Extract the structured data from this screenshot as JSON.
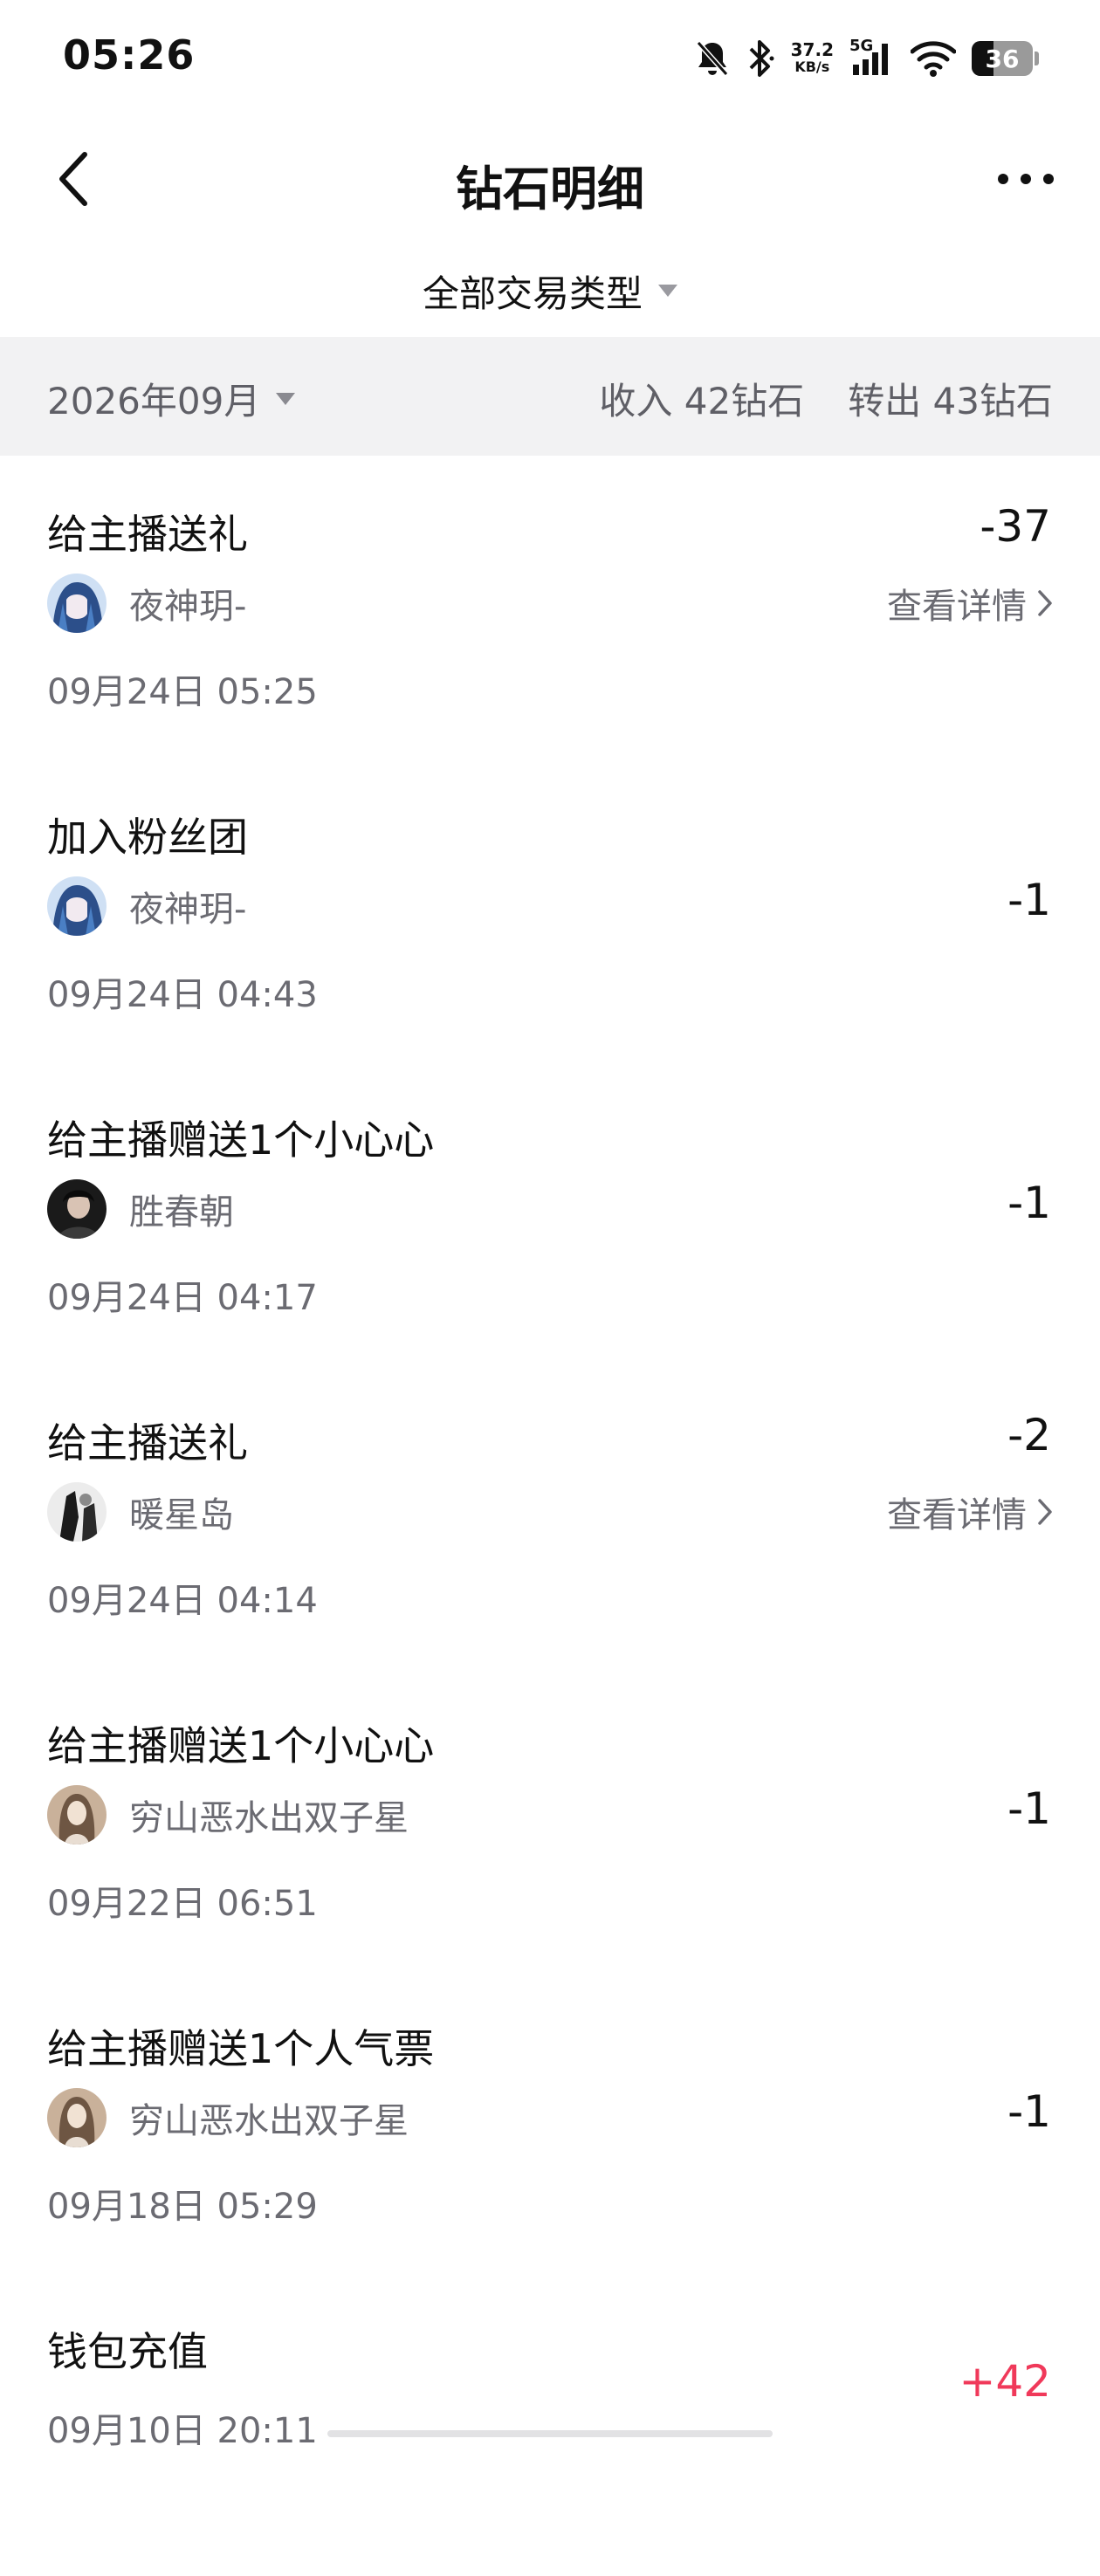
{
  "status_bar": {
    "time": "05:26",
    "net_speed_value": "37.2",
    "net_speed_unit": "KB/s",
    "network_type": "5G",
    "battery_level": "36",
    "battery_fraction": 0.36
  },
  "header": {
    "title": "钻石明细",
    "back_icon": "chevron-left-icon",
    "more_icon": "more-dots-icon"
  },
  "filter": {
    "label": "全部交易类型"
  },
  "month_bar": {
    "month": "2026年09月",
    "income": "收入 42钻石",
    "outgoing": "转出 43钻石"
  },
  "transactions": [
    {
      "title": "给主播送礼",
      "user": "夜神玥-",
      "time": "09月24日 05:25",
      "amount": "-37",
      "detail": "查看详情"
    },
    {
      "title": "加入粉丝团",
      "user": "夜神玥-",
      "time": "09月24日 04:43",
      "amount": "-1"
    },
    {
      "title": "给主播赠送1个小心心",
      "user": "胜春朝",
      "time": "09月24日 04:17",
      "amount": "-1"
    },
    {
      "title": "给主播送礼",
      "user": "暖星岛",
      "time": "09月24日 04:14",
      "amount": "-2",
      "detail": "查看详情"
    },
    {
      "title": "给主播赠送1个小心心",
      "user": "穷山恶水出双子星",
      "time": "09月22日 06:51",
      "amount": "-1"
    },
    {
      "title": "给主播赠送1个人气票",
      "user": "穷山恶水出双子星",
      "time": "09月18日 05:29",
      "amount": "-1"
    },
    {
      "title": "钱包充值",
      "time": "09月10日 20:11",
      "amount": "+42"
    }
  ],
  "colors": {
    "positive_amount": "#f0395a",
    "secondary_text": "#6b6b72",
    "month_bar_bg": "#f2f2f3"
  }
}
